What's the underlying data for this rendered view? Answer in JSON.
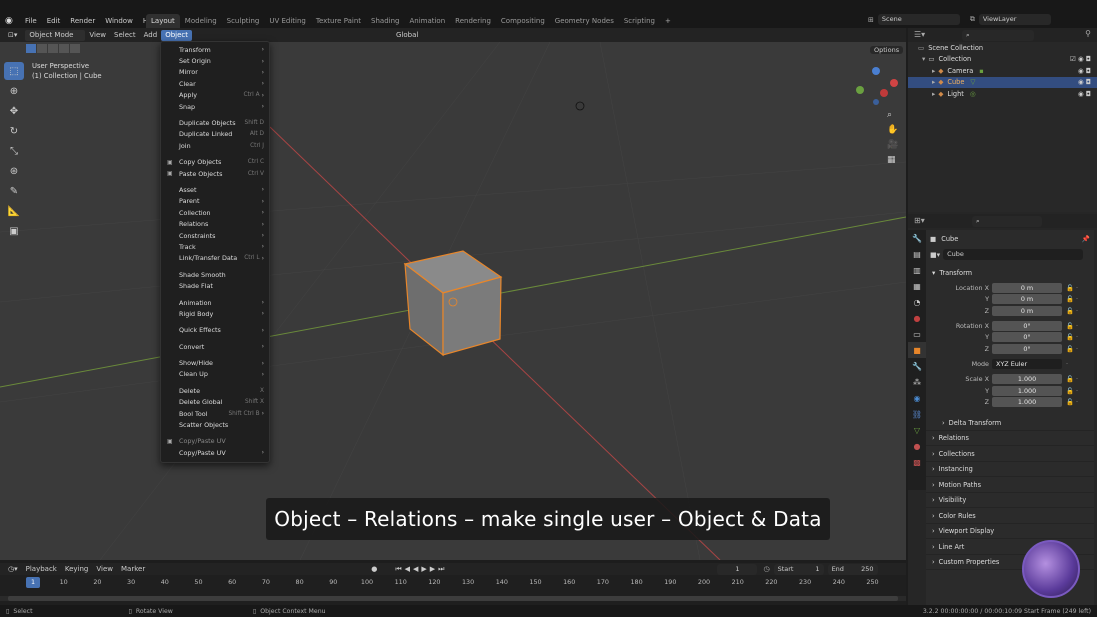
{
  "top_menu": [
    "File",
    "Edit",
    "Render",
    "Window",
    "Help"
  ],
  "workspaces": [
    "Layout",
    "Modeling",
    "Sculpting",
    "UV Editing",
    "Texture Paint",
    "Shading",
    "Animation",
    "Rendering",
    "Compositing",
    "Geometry Nodes",
    "Scripting"
  ],
  "active_workspace": "Layout",
  "scene_name": "Scene",
  "view_layer": "ViewLayer",
  "viewport_header": {
    "mode": "Object Mode",
    "view": "View",
    "select": "Select",
    "add": "Add",
    "object": "Object",
    "transform": "Global",
    "options": "Options"
  },
  "overlay_text": {
    "line1": "User Perspective",
    "line2": "(1) Collection | Cube"
  },
  "object_menu": [
    {
      "label": "Transform",
      "arrow": true
    },
    {
      "label": "Set Origin",
      "arrow": true
    },
    {
      "label": "Mirror",
      "arrow": true
    },
    {
      "label": "Clear",
      "arrow": true
    },
    {
      "label": "Apply",
      "shortcut": "Ctrl A",
      "arrow": true
    },
    {
      "label": "Snap",
      "arrow": true
    },
    {
      "sep": true
    },
    {
      "label": "Duplicate Objects",
      "shortcut": "Shift D"
    },
    {
      "label": "Duplicate Linked",
      "shortcut": "Alt D"
    },
    {
      "label": "Join",
      "shortcut": "Ctrl J"
    },
    {
      "sep": true
    },
    {
      "label": "Copy Objects",
      "shortcut": "Ctrl C",
      "icon": "copy-icon"
    },
    {
      "label": "Paste Objects",
      "shortcut": "Ctrl V",
      "icon": "paste-icon"
    },
    {
      "sep": true
    },
    {
      "label": "Asset",
      "arrow": true
    },
    {
      "label": "Parent",
      "arrow": true
    },
    {
      "label": "Collection",
      "arrow": true
    },
    {
      "label": "Relations",
      "arrow": true
    },
    {
      "label": "Constraints",
      "arrow": true
    },
    {
      "label": "Track",
      "arrow": true
    },
    {
      "label": "Link/Transfer Data",
      "shortcut": "Ctrl L",
      "arrow": true
    },
    {
      "sep": true
    },
    {
      "label": "Shade Smooth"
    },
    {
      "label": "Shade Flat"
    },
    {
      "sep": true
    },
    {
      "label": "Animation",
      "arrow": true
    },
    {
      "label": "Rigid Body",
      "arrow": true
    },
    {
      "sep": true
    },
    {
      "label": "Quick Effects",
      "arrow": true
    },
    {
      "sep": true
    },
    {
      "label": "Convert",
      "arrow": true
    },
    {
      "sep": true
    },
    {
      "label": "Show/Hide",
      "arrow": true
    },
    {
      "label": "Clean Up",
      "arrow": true
    },
    {
      "sep": true
    },
    {
      "label": "Delete",
      "shortcut": "X"
    },
    {
      "label": "Delete Global",
      "shortcut": "Shift X"
    },
    {
      "label": "Bool Tool",
      "shortcut": "Shift Ctrl B",
      "arrow": true
    },
    {
      "label": "Scatter Objects"
    },
    {
      "sep": true
    },
    {
      "label": "Copy/Paste UV",
      "disabled": true,
      "icon": "uv-icon"
    },
    {
      "label": "Copy/Paste UV",
      "arrow": true
    }
  ],
  "caption": "Object – Relations – make single user – Object & Data",
  "outliner": {
    "root": "Scene Collection",
    "items": [
      {
        "label": "Collection",
        "indent": 1
      },
      {
        "label": "Camera",
        "indent": 2
      },
      {
        "label": "Cube",
        "indent": 2,
        "selected": true
      },
      {
        "label": "Light",
        "indent": 2
      }
    ]
  },
  "properties": {
    "object_name": "Cube",
    "data_name": "Cube",
    "transform_label": "Transform",
    "location": {
      "label": "Location X",
      "x": "0 m",
      "y": "0 m",
      "z": "0 m"
    },
    "rotation": {
      "label": "Rotation X",
      "x": "0°",
      "y": "0°",
      "z": "0°"
    },
    "mode": {
      "label": "Mode",
      "value": "XYZ Euler"
    },
    "scale": {
      "label": "Scale X",
      "x": "1.000",
      "y": "1.000",
      "z": "1.000"
    },
    "axis_y": "Y",
    "axis_z": "Z",
    "sections": [
      "Delta Transform",
      "Relations",
      "Collections",
      "Instancing",
      "Motion Paths",
      "Visibility",
      "Color Rules",
      "Viewport Display",
      "Line Art",
      "Custom Properties"
    ]
  },
  "timeline": {
    "menus": [
      "Playback",
      "Keying",
      "View",
      "Marker"
    ],
    "current_frame": "1",
    "start_label": "Start",
    "start": "1",
    "end_label": "End",
    "end": "250",
    "ticks": [
      "1",
      "10",
      "20",
      "30",
      "40",
      "50",
      "60",
      "70",
      "80",
      "90",
      "100",
      "110",
      "120",
      "130",
      "140",
      "150",
      "160",
      "170",
      "180",
      "190",
      "200",
      "210",
      "220",
      "230",
      "240",
      "250"
    ]
  },
  "status": {
    "left": "Select",
    "mid": "Rotate View",
    "right_action": "Object Context Menu",
    "info": "3.2.2   00:00:00:00 / 00:00:10:09   Start Frame (249 left)"
  }
}
